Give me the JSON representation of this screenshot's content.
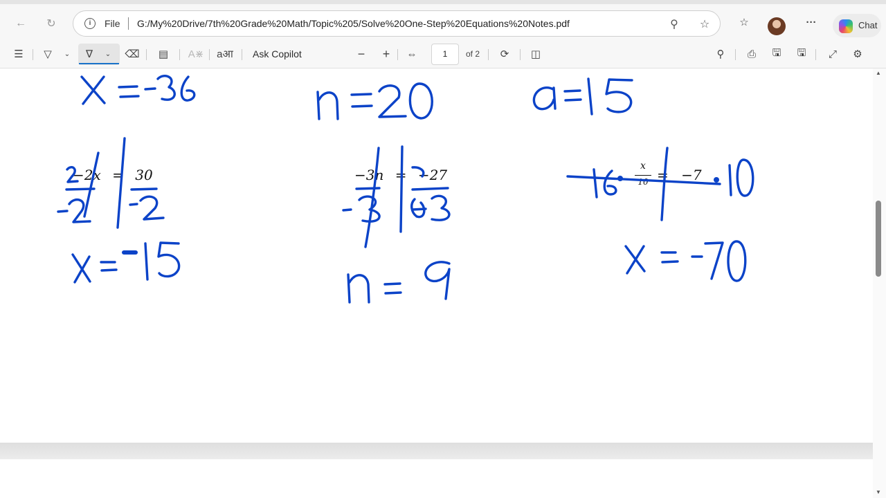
{
  "browser": {
    "address_scheme_label": "File",
    "url": "G:/My%20Drive/7th%20Grade%20Math/Topic%205/Solve%20One-Step%20Equations%20Notes.pdf",
    "chat_label": "Chat"
  },
  "pdf_toolbar": {
    "ask_copilot_label": "Ask Copilot",
    "current_page": "1",
    "page_total_label": "of 2"
  },
  "document": {
    "printed_equations": [
      {
        "left": "−2x",
        "equals": "=",
        "right": "30"
      },
      {
        "left": "−3n",
        "equals": "=",
        "right": "−27"
      },
      {
        "numerator": "x",
        "denominator": "10",
        "equals": "=",
        "right": "−7"
      }
    ],
    "handwritten_answers": [
      "x = -36",
      "n = 20",
      "a = 15",
      "x = -15",
      "n = 9",
      "x = -70"
    ]
  },
  "colors": {
    "ink": "#0c43c8",
    "toolbar_bg": "#f7f7f7",
    "accent": "#1a73c9"
  },
  "icons": [
    "back-arrow-icon",
    "refresh-icon",
    "site-info-icon",
    "zoom-icon",
    "favorite-star-icon",
    "favorites-list-icon",
    "more-icon",
    "copilot-icon",
    "table-of-contents-icon",
    "highlight-icon",
    "draw-icon",
    "erase-icon",
    "add-text-icon",
    "text-to-speech-icon",
    "translate-icon",
    "zoom-out-icon",
    "zoom-in-icon",
    "fit-page-icon",
    "rotate-icon",
    "page-view-icon",
    "search-icon",
    "print-icon",
    "save-icon",
    "save-as-icon",
    "fullscreen-icon",
    "settings-icon"
  ]
}
